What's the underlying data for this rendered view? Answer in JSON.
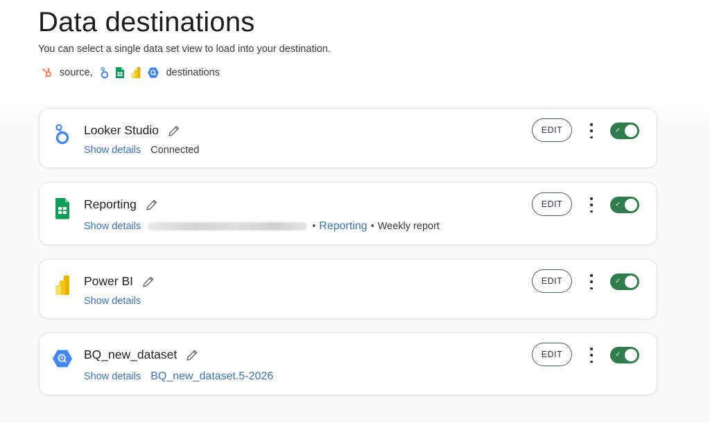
{
  "header": {
    "title": "Data destinations",
    "subtitle": "You can select a single data set view to load into your destination.",
    "source_label": "source,",
    "destinations_label": "destinations"
  },
  "icons": {
    "source": "hubspot-icon",
    "destinations": [
      "looker-studio-icon",
      "google-sheets-icon",
      "power-bi-icon",
      "bigquery-icon"
    ]
  },
  "colors": {
    "link": "#3b73b9",
    "toggle_on": "#2f7d4c",
    "hubspot": "#ff7a59",
    "looker": "#4285f4",
    "sheets": "#0f9d58",
    "powerbi": "#f2c811",
    "bigquery": "#4386fa"
  },
  "destinations": [
    {
      "name": "Looker Studio",
      "icon": "looker-studio-icon",
      "show_details": "Show details",
      "status": "Connected",
      "edit_label": "EDIT",
      "enabled": true
    },
    {
      "name": "Reporting",
      "icon": "google-sheets-icon",
      "show_details": "Show details",
      "sheet_link": "Reporting",
      "sheet_tab": "Weekly report",
      "edit_label": "EDIT",
      "enabled": true
    },
    {
      "name": "Power BI",
      "icon": "power-bi-icon",
      "show_details": "Show details",
      "edit_label": "EDIT",
      "enabled": true
    },
    {
      "name": "BQ_new_dataset",
      "icon": "bigquery-icon",
      "show_details": "Show details",
      "dataset_link": "BQ_new_dataset.5-2026",
      "edit_label": "EDIT",
      "enabled": true
    }
  ]
}
